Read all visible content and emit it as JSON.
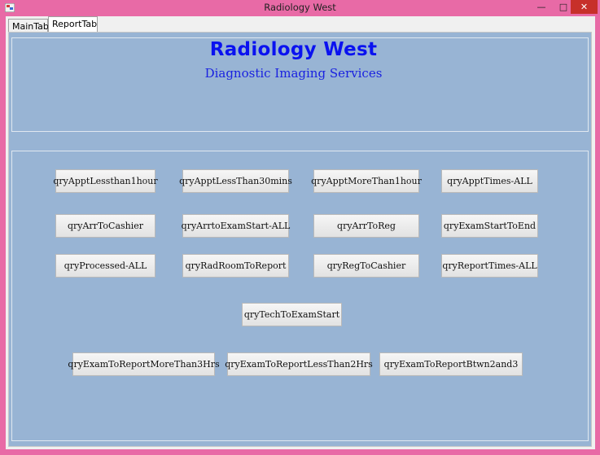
{
  "window": {
    "title": "Radiology West",
    "minimize_glyph": "—",
    "maximize_glyph": "□",
    "close_glyph": "✕"
  },
  "tabs": [
    {
      "label": "MainTab"
    },
    {
      "label": "ReportTab"
    }
  ],
  "header": {
    "title": "Radiology West",
    "subtitle": "Diagnostic Imaging Services"
  },
  "buttons": [
    {
      "label": "qryApptLessthan1hour"
    },
    {
      "label": "qryApptLessThan30mins"
    },
    {
      "label": "qryApptMoreThan1hour"
    },
    {
      "label": "qryApptTimes-ALL"
    },
    {
      "label": "qryArrToCashier"
    },
    {
      "label": "qryArrtoExamStart-ALL"
    },
    {
      "label": "qryArrToReg"
    },
    {
      "label": "qryExamStartToEnd"
    },
    {
      "label": "qryProcessed-ALL"
    },
    {
      "label": "qryRadRoomToReport"
    },
    {
      "label": "qryRegToCashier"
    },
    {
      "label": "qryReportTimes-ALL"
    },
    {
      "label": "qryTechToExamStart"
    },
    {
      "label": "qryExamToReportMoreThan3Hrs"
    },
    {
      "label": "qryExamToReportLessThan2Hrs"
    },
    {
      "label": "qryExamToReportBtwn2and3"
    }
  ]
}
